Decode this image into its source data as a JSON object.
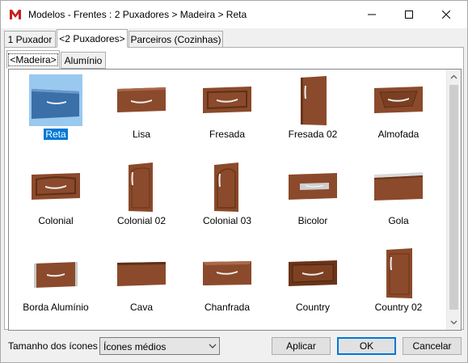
{
  "window": {
    "title": "Modelos - Frentes : 2 Puxadores > Madeira > Reta",
    "app_icon": "m-logo-icon",
    "controls": [
      "minimize-icon",
      "maximize-icon",
      "close-icon"
    ]
  },
  "tabs": [
    {
      "label": "1 Puxador",
      "active": false
    },
    {
      "label": "<2 Puxadores>",
      "active": true
    },
    {
      "label": "Parceiros (Cozinhas)",
      "active": false
    }
  ],
  "subtabs": [
    {
      "label": "<Madeira>",
      "active": true
    },
    {
      "label": "Alumínio",
      "active": false
    }
  ],
  "items": [
    {
      "label": "Reta",
      "selected": true
    },
    {
      "label": "Lisa",
      "selected": false
    },
    {
      "label": "Fresada",
      "selected": false
    },
    {
      "label": "Fresada 02",
      "selected": false
    },
    {
      "label": "Almofada",
      "selected": false
    },
    {
      "label": "Colonial",
      "selected": false
    },
    {
      "label": "Colonial 02",
      "selected": false
    },
    {
      "label": "Colonial 03",
      "selected": false
    },
    {
      "label": "Bicolor",
      "selected": false
    },
    {
      "label": "Gola",
      "selected": false
    },
    {
      "label": "Borda Alumínio",
      "selected": false
    },
    {
      "label": "Cava",
      "selected": false
    },
    {
      "label": "Chanfrada",
      "selected": false
    },
    {
      "label": "Country",
      "selected": false
    },
    {
      "label": "Country 02",
      "selected": false
    }
  ],
  "bottom": {
    "size_label": "Tamanho dos ícones",
    "size_value": "Ícones médios",
    "apply": "Aplicar",
    "ok": "OK",
    "cancel": "Cancelar"
  },
  "colors": {
    "wood": "#8b4a2b",
    "selected_door": "#3a6fa8",
    "selection": "#0078d7"
  }
}
